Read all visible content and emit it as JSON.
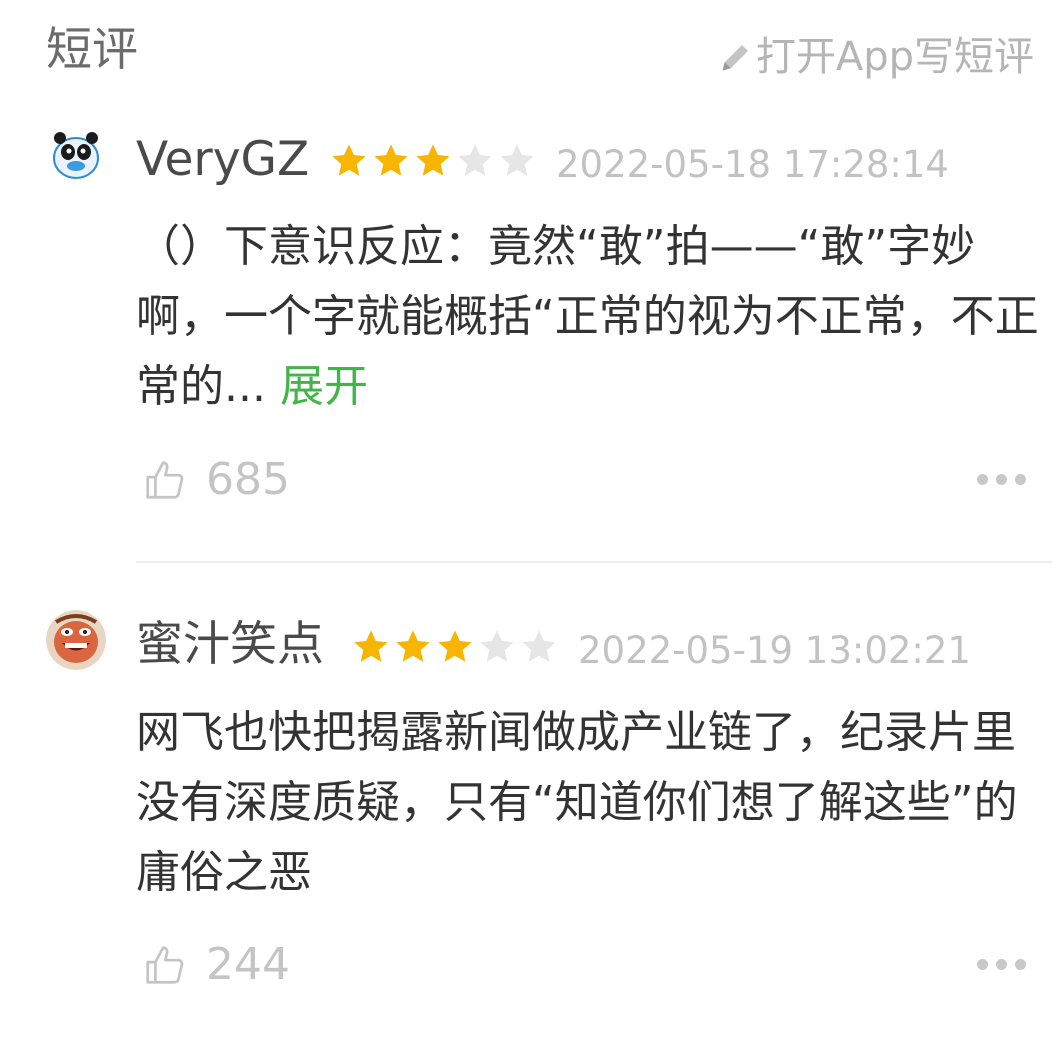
{
  "header": {
    "title": "短评",
    "write_link": "打开App写短评"
  },
  "reviews": [
    {
      "username": "VeryGZ",
      "rating": 3,
      "max_rating": 5,
      "timestamp": "2022-05-18 17:28:14",
      "text": "（）下意识反应：竟然“敢”拍——“敢”字妙啊，一个字就能概括“正常的视为不正常，不正常的...",
      "expand_label": "展开",
      "likes": "685",
      "avatar_icon": "panda-avatar-icon"
    },
    {
      "username": "蜜汁笑点",
      "rating": 3,
      "max_rating": 5,
      "timestamp": "2022-05-19 13:02:21",
      "text": "网飞也快把揭露新闻做成产业链了，纪录片里没有深度质疑，只有“知道你们想了解这些”的庸俗之恶",
      "likes": "244",
      "avatar_icon": "cartoon-face-avatar-icon"
    }
  ],
  "colors": {
    "star_filled": "#f7b500",
    "star_empty": "#e6e6e6",
    "expand": "#42b548"
  }
}
